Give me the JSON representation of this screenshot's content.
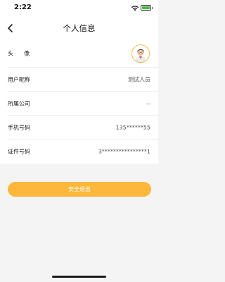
{
  "status_bar": {
    "time": "2:22"
  },
  "nav": {
    "title": "个人信息"
  },
  "profile": {
    "rows": [
      {
        "label": "头      像",
        "value": ""
      },
      {
        "label": "用户昵称",
        "value": "测试人员"
      },
      {
        "label": "所属公司",
        "value": "--"
      },
      {
        "label": "手机号码",
        "value": "135******55"
      },
      {
        "label": "证件号码",
        "value": "3****************1"
      }
    ]
  },
  "actions": {
    "logout_label": "安全退出"
  },
  "colors": {
    "accent": "#fdb73b",
    "avatar_ring": "#f4b73f",
    "page_background": "#f4f4f4",
    "card_background": "#ffffff"
  },
  "icons": {
    "back": "chevron-left-icon",
    "wifi": "wifi-icon",
    "battery": "battery-icon",
    "avatar": "avatar-icon"
  }
}
